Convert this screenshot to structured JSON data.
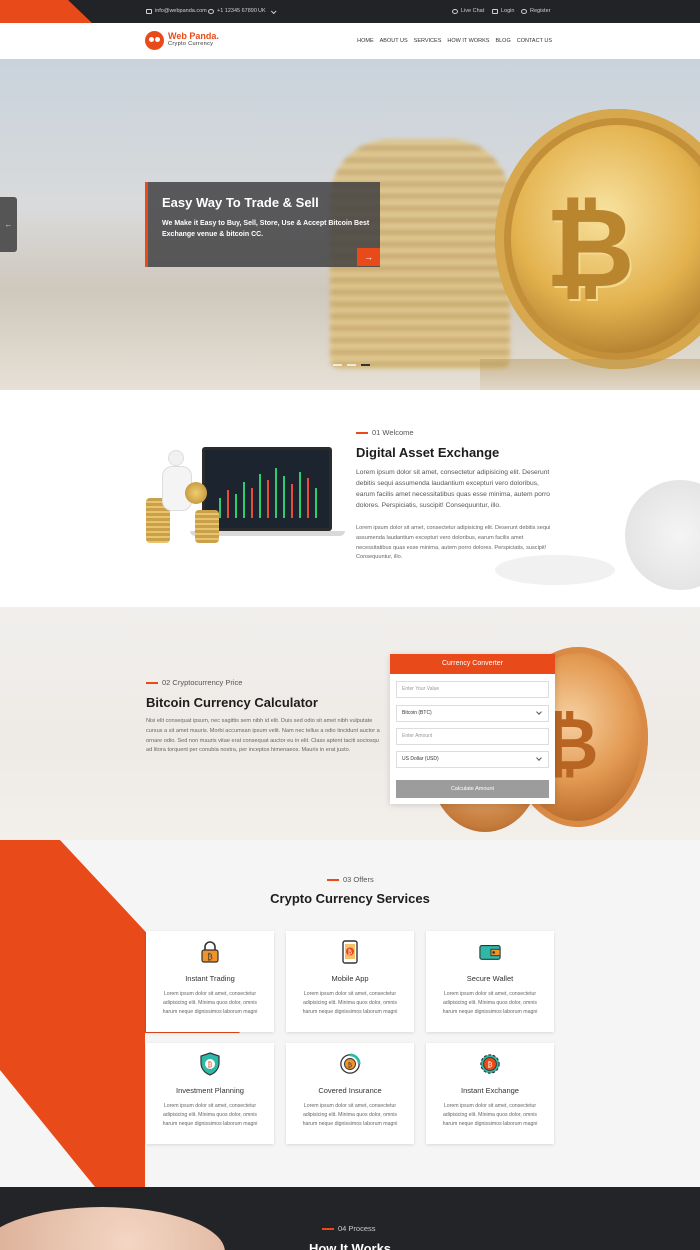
{
  "topbar": {
    "email": "info@webpanda.com",
    "phone": "+1 12345 67890",
    "language": "UK",
    "live_chat": "Live Chat",
    "login": "Login",
    "register": "Register"
  },
  "brand": {
    "name": "Web Panda.",
    "tagline": "Crypto Currency",
    "accent_color": "#e94a1a"
  },
  "nav": [
    "HOME",
    "ABOUT US",
    "SERVICES",
    "HOW IT WORKS",
    "BLOG",
    "CONTACT US"
  ],
  "hero": {
    "title": "Easy Way To Trade & Sell",
    "subtitle": "We Make it Easy to Buy, Sell, Store, Use & Accept Bitcoin Best Exchange venue & bitcoin CC.",
    "arrow": "→",
    "prev_arrow": "←",
    "slides": 3,
    "active_slide": 3
  },
  "welcome": {
    "label": "01 Welcome",
    "title": "Digital Asset Exchange",
    "para1": "Lorem ipsum dolor sit amet, consectetur adipisicing elit. Deserunt debitis sequi assumenda laudantium excepturi vero doloribus, earum facilis amet necessitatibus quas esse minima, autem porro dolores. Perspiciatis, suscipit! Consequuntur, illo.",
    "para2": "Lorem ipsum dolor sit amet, consectetur adipisicing elit. Deserunt debitis sequi assumenda laudantium excepturi vero doloribus, earum facilis amet necessitatibus quas esse minima, autem porro dolores. Perspiciatis, suscipit! Consequuntur, illo."
  },
  "calculator": {
    "label": "02 Cryptocurrency Price",
    "title": "Bitcoin Currency Calculator",
    "para": "Nisi elit consequat ipsum, nec sagittis sem nibh id elit. Duis sed odio sit amet nibh vulputate cursus a sit amet mauris. Morbi accumsan ipsum velit. Nam nec tellus a odio tincidunt auctor a ornare odio. Sed non mauris vitae erat consequat auctor eu in elit. Class aptent taciti sociosqu ad litora torquent per conubia nostra, per inceptos himenaeos. Mauris in erat justo.",
    "converter": {
      "heading": "Currency Converter",
      "value_placeholder": "Enter Your Value",
      "from_currency": "Bitcoin (BTC)",
      "amount_placeholder": "Enter Amount",
      "to_currency": "US Dollar (USD)",
      "button": "Calculate Amount"
    }
  },
  "offers": {
    "label": "03 Offers",
    "title": "Crypto Currency Services",
    "card_text": "Lorem ipsum dolor sit amet, consectetur adipisicing elit. Minima quos dolor, omnis harum neque dignissimos laborum magni",
    "cards": [
      {
        "title": "Instant Trading",
        "icon": "padlock-bitcoin-icon"
      },
      {
        "title": "Mobile App",
        "icon": "mobile-bitcoin-icon"
      },
      {
        "title": "Secure Wallet",
        "icon": "wallet-icon"
      },
      {
        "title": "Investment Planning",
        "icon": "shield-bitcoin-icon"
      },
      {
        "title": "Covered Insurance",
        "icon": "insurance-coin-icon"
      },
      {
        "title": "Instant Exchange",
        "icon": "gear-bitcoin-icon"
      }
    ]
  },
  "process": {
    "label": "04 Process",
    "title": "How It Works"
  }
}
